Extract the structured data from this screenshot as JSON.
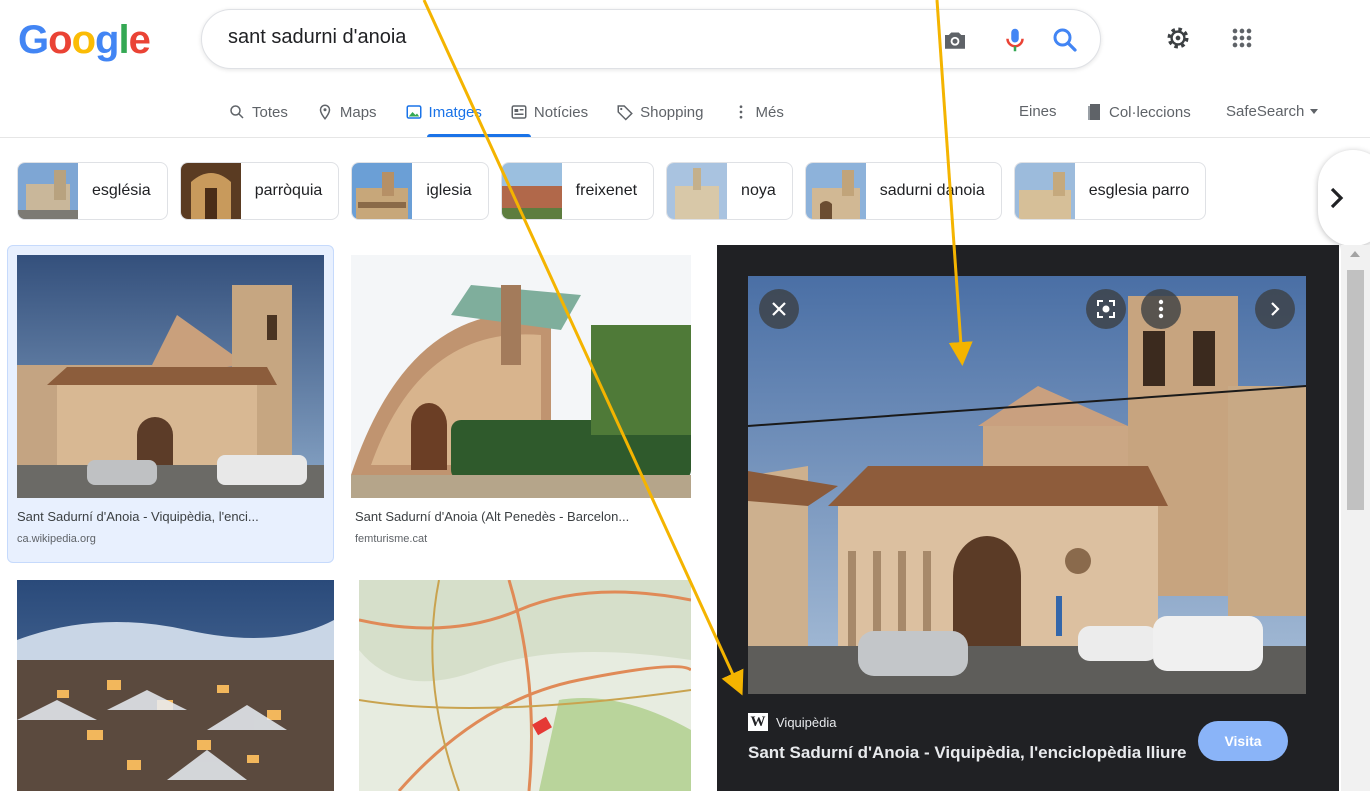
{
  "header": {
    "logo": [
      "G",
      "o",
      "o",
      "g",
      "l",
      "e"
    ],
    "search_value": "sant sadurni d'anoia"
  },
  "tabs": [
    {
      "label": "Totes",
      "icon": "search-icon"
    },
    {
      "label": "Maps",
      "icon": "map-pin-icon"
    },
    {
      "label": "Imatges",
      "icon": "image-icon",
      "active": true
    },
    {
      "label": "Notícies",
      "icon": "news-icon"
    },
    {
      "label": "Shopping",
      "icon": "tag-icon"
    },
    {
      "label": "Més",
      "icon": "more-vert-icon"
    }
  ],
  "tools": {
    "eines": "Eines",
    "collections": "Col·leccions",
    "safesearch": "SafeSearch"
  },
  "chips": [
    "església",
    "parròquia",
    "iglesia",
    "freixenet",
    "noya",
    "sadurni danoia",
    "esglesia parro"
  ],
  "results": [
    {
      "title": "Sant Sadurní d'Anoia - Viquipèdia, l'enci...",
      "site": "ca.wikipedia.org"
    },
    {
      "title": "Sant Sadurní d'Anoia (Alt Penedès - Barcelon...",
      "site": "femturisme.cat"
    }
  ],
  "preview": {
    "source": "Viquipèdia",
    "title": "Sant Sadurní d'Anoia - Viquipèdia, l'enciclopèdia lliure",
    "visit_label": "Visita"
  },
  "colors": {
    "accent": "#1a73e8",
    "annotation_arrow": "#f4b400",
    "panel_bg": "#202124"
  }
}
